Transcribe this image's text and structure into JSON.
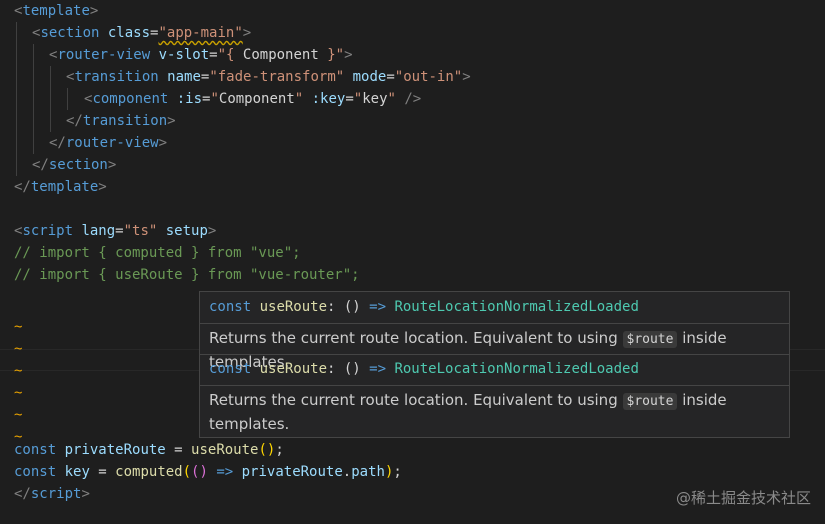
{
  "editor": {
    "lines": {
      "l1": {
        "open": "<",
        "tag": "template",
        "close": ">"
      },
      "l2": {
        "open": "<",
        "tag": "section",
        "attr": " class",
        "eq": "=",
        "val": "\"app-main\"",
        "close": ">"
      },
      "l3": {
        "open": "<",
        "tag": "router-view",
        "attr": " v-slot",
        "eq": "=",
        "val1": "\"{ ",
        "comp": "Component",
        "val2": " }\"",
        "close": ">"
      },
      "l4": {
        "open": "<",
        "tag": "transition",
        "attr1": " name",
        "eq1": "=",
        "val1": "\"fade-transform\"",
        "attr2": " mode",
        "eq2": "=",
        "val2": "\"out-in\"",
        "close": ">"
      },
      "l5": {
        "open": "<",
        "tag": "component",
        "attr1": " :is",
        "eq1": "=",
        "q1": "\"",
        "v1": "Component",
        "q2": "\"",
        "attr2": " :key",
        "eq2": "=",
        "q3": "\"",
        "v2": "key",
        "q4": "\"",
        "close": " />"
      },
      "l6": {
        "open": "</",
        "tag": "transition",
        "close": ">"
      },
      "l7": {
        "open": "</",
        "tag": "router-view",
        "close": ">"
      },
      "l8": {
        "open": "</",
        "tag": "section",
        "close": ">"
      },
      "l9": {
        "open": "</",
        "tag": "template",
        "close": ">"
      },
      "l11": {
        "open": "<",
        "tag": "script",
        "attr1": " lang",
        "eq1": "=",
        "val1": "\"ts\"",
        "attr2": " setup",
        "close": ">"
      },
      "l12": "// import { computed } from \"vue\";",
      "l13": "// import { useRoute } from \"vue-router\";",
      "tilde": "~",
      "l20": {
        "kw": "const",
        "name": " privateRoute",
        "eq": " = ",
        "fn": "useRoute",
        "p1": "(",
        ")": ")",
        "end": ";"
      },
      "l21": {
        "kw": "const",
        "name": " key",
        "eq": " = ",
        "fn": "computed",
        "p1": "(",
        "p2": "()",
        "arrow": " => ",
        "obj": "privateRoute",
        "dot": ".",
        "prop": "path",
        "p3": ")",
        "end": ";"
      },
      "l22": {
        "open": "</",
        "tag": "script",
        "close": ">"
      }
    }
  },
  "hover": {
    "sig": {
      "kw": "const",
      "name": " useRoute",
      "colon": ": ",
      "parens": "()",
      "arrow": " => ",
      "type": "RouteLocationNormalizedLoaded"
    },
    "doc_before": "Returns the current route location. Equivalent to using",
    "doc_code": "$route",
    "doc_after": "inside templates.",
    "doc2_before": "Returns the current route location. Equivalent to using",
    "doc2_after1": "inside",
    "doc2_after2": "templates."
  },
  "watermark": "@稀土掘金技术社区"
}
